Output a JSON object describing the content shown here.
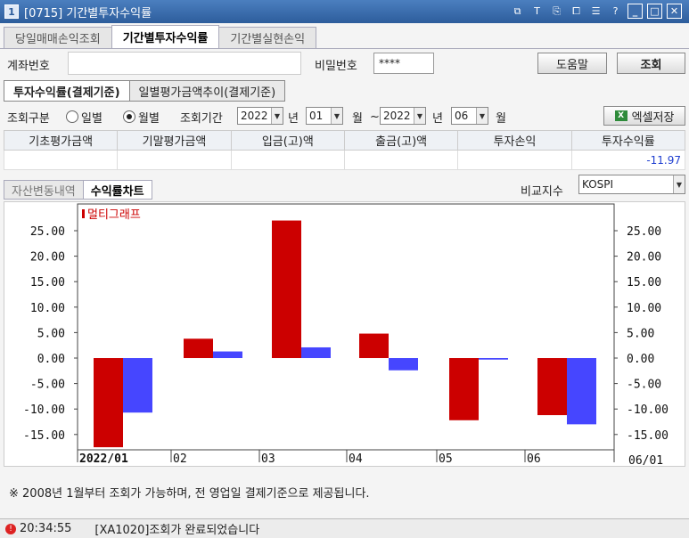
{
  "window": {
    "badge": "1",
    "title": "[0715] 기간별투자수익률"
  },
  "title_tools": [
    "T",
    "?"
  ],
  "tabs": [
    "당일매매손익조회",
    "기간별투자수익률",
    "기간별실현손익"
  ],
  "account": {
    "label": "계좌번호",
    "value": "",
    "password_label": "비밀번호",
    "password_value": "****"
  },
  "buttons": {
    "help": "도움말",
    "query": "조회",
    "excel": "엑셀저장"
  },
  "subtabs": [
    "투자수익률(결제기준)",
    "일별평가금액추이(결제기준)"
  ],
  "criteria": {
    "type_label": "조회구분",
    "daily": "일별",
    "monthly": "월별",
    "period_label": "조회기간",
    "from_year": "2022",
    "year_unit": "년",
    "from_month": "01",
    "month_unit": "월",
    "tilde": "~",
    "to_year": "2022",
    "to_month": "06"
  },
  "summary": {
    "headers": [
      "기초평가금액",
      "기말평가금액",
      "입금(고)액",
      "출금(고)액",
      "투자손익",
      "투자수익률"
    ],
    "values": [
      "",
      "",
      "",
      "",
      "",
      "-11.97"
    ]
  },
  "chart_tabs": [
    "자산변동내역",
    "수익률차트"
  ],
  "compare": {
    "label": "비교지수",
    "value": "KOSPI"
  },
  "chart_data": {
    "type": "bar",
    "categories": [
      "2022/01",
      "02",
      "03",
      "04",
      "05",
      "06"
    ],
    "end_label": "06/01",
    "legend": "멀티그래프",
    "series": [
      {
        "name": "",
        "color": "#cc0000",
        "values": [
          -17.5,
          3.8,
          27.0,
          4.8,
          -12.2,
          -11.2
        ]
      },
      {
        "name": "",
        "color": "#4646ff",
        "values": [
          -10.7,
          1.3,
          2.1,
          -2.4,
          -0.3,
          -13.0
        ]
      }
    ],
    "yticks": [
      "25.00",
      "20.00",
      "15.00",
      "10.00",
      "5.00",
      "0.00",
      "-5.00",
      "-10.00",
      "-15.00"
    ],
    "ylim": [
      -17.5,
      27.0
    ]
  },
  "note": "※ 2008년 1월부터 조회가 가능하며, 전 영업일 결제기준으로 제공됩니다.",
  "status": {
    "time": "20:34:55",
    "message": "[XA1020]조회가 완료되었습니다"
  }
}
